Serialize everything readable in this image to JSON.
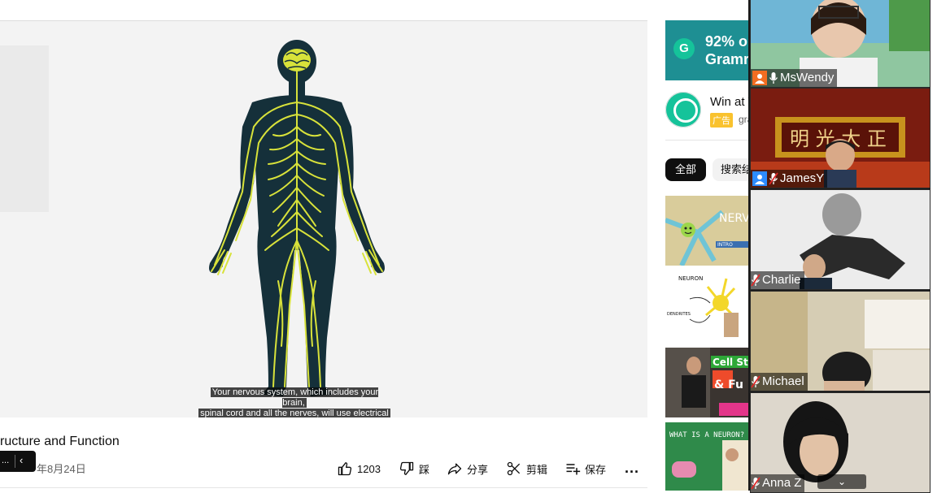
{
  "video": {
    "captions": [
      "Your nervous system, which includes your brain,",
      "spinal cord and all the nerves, will use electrical"
    ],
    "title": "ructure and Function",
    "upload_date": "年8月24日",
    "mini_player_dots": "..."
  },
  "actions": {
    "like_count": "1203",
    "dislike_label": "踩",
    "share_label": "分享",
    "clip_label": "剪辑",
    "save_label": "保存",
    "more_label": "..."
  },
  "ad": {
    "banner_line1": "92% o",
    "banner_line2": "Gramr",
    "banner_logo": "G",
    "title": "Win at W",
    "badge": "广告",
    "domain": "gra"
  },
  "chips": [
    "全部",
    "搜索结"
  ],
  "thumbnails": [
    {
      "caption": "NERVO SYSTE",
      "sub": "INTRO"
    },
    {
      "caption": "NEURON",
      "sub": "DENDRITES"
    },
    {
      "caption": "Cell Str",
      "sub": "& Fu"
    },
    {
      "caption": "WHAT IS A NEURON?",
      "sub": ""
    }
  ],
  "participants": [
    {
      "name": "MsWendy",
      "badge_color": "#f26d21",
      "muted": false
    },
    {
      "name": "JamesY",
      "badge_color": "#2d8cff",
      "muted": true
    },
    {
      "name": "Charlie",
      "badge_color": "",
      "muted": true
    },
    {
      "name": "Michael",
      "badge_color": "",
      "muted": true
    },
    {
      "name": "Anna Z",
      "badge_color": "",
      "muted": true
    }
  ],
  "colors": {
    "nerve": "#d8e23a",
    "body": "#15303a",
    "grammarly": "#15c39a"
  }
}
